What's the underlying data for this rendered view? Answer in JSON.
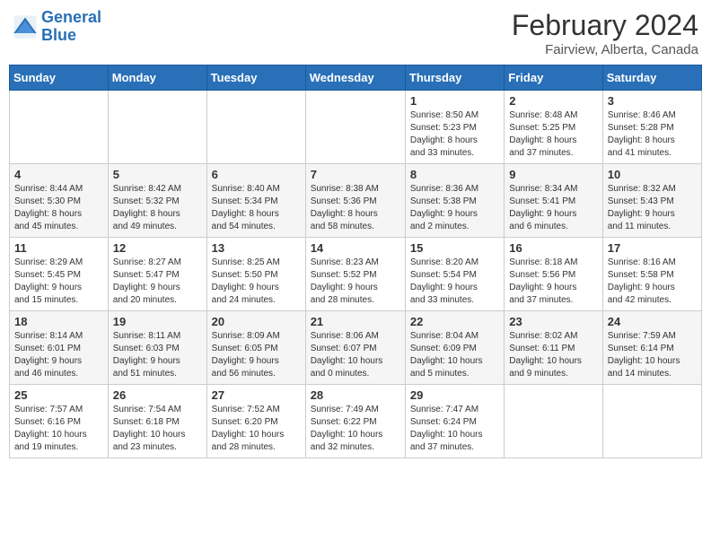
{
  "logo": {
    "line1": "General",
    "line2": "Blue"
  },
  "title": "February 2024",
  "subtitle": "Fairview, Alberta, Canada",
  "days_of_week": [
    "Sunday",
    "Monday",
    "Tuesday",
    "Wednesday",
    "Thursday",
    "Friday",
    "Saturday"
  ],
  "weeks": [
    [
      {
        "day": "",
        "info": ""
      },
      {
        "day": "",
        "info": ""
      },
      {
        "day": "",
        "info": ""
      },
      {
        "day": "",
        "info": ""
      },
      {
        "day": "1",
        "info": "Sunrise: 8:50 AM\nSunset: 5:23 PM\nDaylight: 8 hours\nand 33 minutes."
      },
      {
        "day": "2",
        "info": "Sunrise: 8:48 AM\nSunset: 5:25 PM\nDaylight: 8 hours\nand 37 minutes."
      },
      {
        "day": "3",
        "info": "Sunrise: 8:46 AM\nSunset: 5:28 PM\nDaylight: 8 hours\nand 41 minutes."
      }
    ],
    [
      {
        "day": "4",
        "info": "Sunrise: 8:44 AM\nSunset: 5:30 PM\nDaylight: 8 hours\nand 45 minutes."
      },
      {
        "day": "5",
        "info": "Sunrise: 8:42 AM\nSunset: 5:32 PM\nDaylight: 8 hours\nand 49 minutes."
      },
      {
        "day": "6",
        "info": "Sunrise: 8:40 AM\nSunset: 5:34 PM\nDaylight: 8 hours\nand 54 minutes."
      },
      {
        "day": "7",
        "info": "Sunrise: 8:38 AM\nSunset: 5:36 PM\nDaylight: 8 hours\nand 58 minutes."
      },
      {
        "day": "8",
        "info": "Sunrise: 8:36 AM\nSunset: 5:38 PM\nDaylight: 9 hours\nand 2 minutes."
      },
      {
        "day": "9",
        "info": "Sunrise: 8:34 AM\nSunset: 5:41 PM\nDaylight: 9 hours\nand 6 minutes."
      },
      {
        "day": "10",
        "info": "Sunrise: 8:32 AM\nSunset: 5:43 PM\nDaylight: 9 hours\nand 11 minutes."
      }
    ],
    [
      {
        "day": "11",
        "info": "Sunrise: 8:29 AM\nSunset: 5:45 PM\nDaylight: 9 hours\nand 15 minutes."
      },
      {
        "day": "12",
        "info": "Sunrise: 8:27 AM\nSunset: 5:47 PM\nDaylight: 9 hours\nand 20 minutes."
      },
      {
        "day": "13",
        "info": "Sunrise: 8:25 AM\nSunset: 5:50 PM\nDaylight: 9 hours\nand 24 minutes."
      },
      {
        "day": "14",
        "info": "Sunrise: 8:23 AM\nSunset: 5:52 PM\nDaylight: 9 hours\nand 28 minutes."
      },
      {
        "day": "15",
        "info": "Sunrise: 8:20 AM\nSunset: 5:54 PM\nDaylight: 9 hours\nand 33 minutes."
      },
      {
        "day": "16",
        "info": "Sunrise: 8:18 AM\nSunset: 5:56 PM\nDaylight: 9 hours\nand 37 minutes."
      },
      {
        "day": "17",
        "info": "Sunrise: 8:16 AM\nSunset: 5:58 PM\nDaylight: 9 hours\nand 42 minutes."
      }
    ],
    [
      {
        "day": "18",
        "info": "Sunrise: 8:14 AM\nSunset: 6:01 PM\nDaylight: 9 hours\nand 46 minutes."
      },
      {
        "day": "19",
        "info": "Sunrise: 8:11 AM\nSunset: 6:03 PM\nDaylight: 9 hours\nand 51 minutes."
      },
      {
        "day": "20",
        "info": "Sunrise: 8:09 AM\nSunset: 6:05 PM\nDaylight: 9 hours\nand 56 minutes."
      },
      {
        "day": "21",
        "info": "Sunrise: 8:06 AM\nSunset: 6:07 PM\nDaylight: 10 hours\nand 0 minutes."
      },
      {
        "day": "22",
        "info": "Sunrise: 8:04 AM\nSunset: 6:09 PM\nDaylight: 10 hours\nand 5 minutes."
      },
      {
        "day": "23",
        "info": "Sunrise: 8:02 AM\nSunset: 6:11 PM\nDaylight: 10 hours\nand 9 minutes."
      },
      {
        "day": "24",
        "info": "Sunrise: 7:59 AM\nSunset: 6:14 PM\nDaylight: 10 hours\nand 14 minutes."
      }
    ],
    [
      {
        "day": "25",
        "info": "Sunrise: 7:57 AM\nSunset: 6:16 PM\nDaylight: 10 hours\nand 19 minutes."
      },
      {
        "day": "26",
        "info": "Sunrise: 7:54 AM\nSunset: 6:18 PM\nDaylight: 10 hours\nand 23 minutes."
      },
      {
        "day": "27",
        "info": "Sunrise: 7:52 AM\nSunset: 6:20 PM\nDaylight: 10 hours\nand 28 minutes."
      },
      {
        "day": "28",
        "info": "Sunrise: 7:49 AM\nSunset: 6:22 PM\nDaylight: 10 hours\nand 32 minutes."
      },
      {
        "day": "29",
        "info": "Sunrise: 7:47 AM\nSunset: 6:24 PM\nDaylight: 10 hours\nand 37 minutes."
      },
      {
        "day": "",
        "info": ""
      },
      {
        "day": "",
        "info": ""
      }
    ]
  ]
}
